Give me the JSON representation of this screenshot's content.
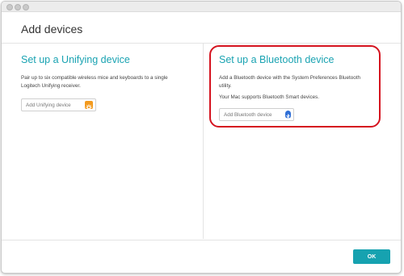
{
  "window": {
    "title": "Add devices"
  },
  "unifying": {
    "title": "Set up a Unifying device",
    "description_line1": "Pair up to six compatible wireless mice and keyboards to a single",
    "description_line2": "Logitech Unifying receiver.",
    "button_label": "Add Unifying device",
    "icon": "unifying-icon"
  },
  "bluetooth": {
    "title": "Set up a Bluetooth device",
    "description_line1": "Add a Bluetooth device with the System Preferences Bluetooth",
    "description_line2": "utility.",
    "note": "Your Mac supports Bluetooth Smart devices.",
    "button_label": "Add Bluetooth device",
    "icon": "bluetooth-icon"
  },
  "footer": {
    "ok_label": "OK"
  },
  "colors": {
    "accent": "#1aa3b2",
    "ok_button": "#16a2b0",
    "highlight": "#d5131f",
    "unifying_icon": "#f39a1e",
    "bluetooth_icon": "#2f6fd6"
  }
}
